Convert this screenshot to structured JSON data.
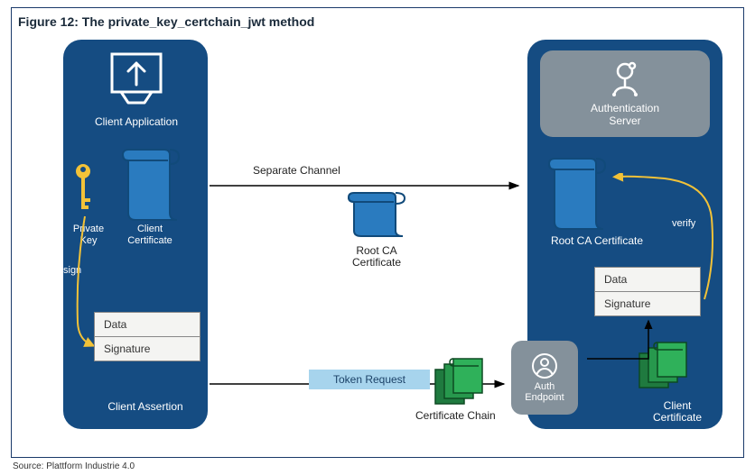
{
  "figure_title": "Figure 12: The private_key_certchain_jwt method",
  "source": "Source: Plattform Industrie 4.0",
  "left": {
    "client_app": "Client Application",
    "private_key": "Private\nKey",
    "client_cert": "Client\nCertificate",
    "sign": "sign",
    "data": "Data",
    "signature": "Signature",
    "client_assertion": "Client Assertion"
  },
  "middle": {
    "separate_channel": "Separate Channel",
    "root_ca": "Root CA\nCertificate",
    "token_request": "Token Request",
    "cert_chain": "Certificate Chain"
  },
  "right": {
    "auth_server": "Authentication\nServer",
    "root_ca": "Root CA Certificate",
    "verify": "verify",
    "data": "Data",
    "signature": "Signature",
    "auth_endpoint": "Auth\nEndpoint",
    "client_cert": "Client\nCertificate"
  }
}
